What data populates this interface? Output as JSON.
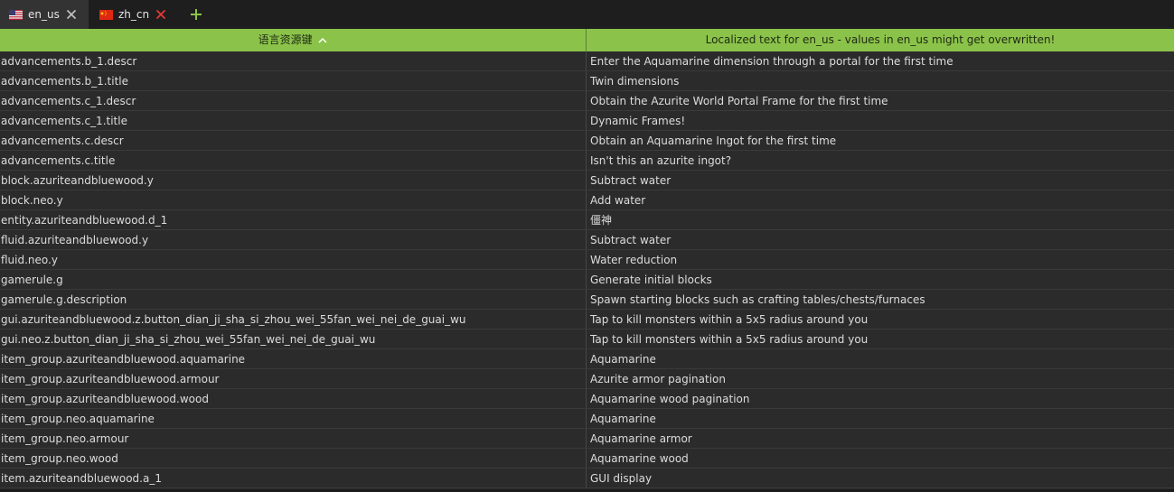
{
  "tabs": [
    {
      "label": "en_us"
    },
    {
      "label": "zh_cn"
    }
  ],
  "colors": {
    "accent": "#8bc34a",
    "close_inactive": "#e53935"
  },
  "table": {
    "headers": [
      "语言资源键",
      "Localized text for en_us - values in en_us might get overwritten!"
    ],
    "rows": [
      {
        "key": "advancements.b_1.descr",
        "value": "Enter the Aquamarine dimension through a portal for the first time"
      },
      {
        "key": "advancements.b_1.title",
        "value": "Twin dimensions"
      },
      {
        "key": "advancements.c_1.descr",
        "value": "Obtain the Azurite World Portal Frame for the first time"
      },
      {
        "key": "advancements.c_1.title",
        "value": "Dynamic Frames!"
      },
      {
        "key": "advancements.c.descr",
        "value": "Obtain an Aquamarine Ingot for the first time"
      },
      {
        "key": "advancements.c.title",
        "value": "Isn't this an azurite ingot?"
      },
      {
        "key": "block.azuriteandbluewood.y",
        "value": "Subtract water"
      },
      {
        "key": "block.neo.y",
        "value": "Add water"
      },
      {
        "key": "entity.azuriteandbluewood.d_1",
        "value": "僵神"
      },
      {
        "key": "fluid.azuriteandbluewood.y",
        "value": "Subtract water"
      },
      {
        "key": "fluid.neo.y",
        "value": "Water reduction"
      },
      {
        "key": "gamerule.g",
        "value": "Generate initial blocks"
      },
      {
        "key": "gamerule.g.description",
        "value": "Spawn starting blocks such as crafting tables/chests/furnaces"
      },
      {
        "key": "gui.azuriteandbluewood.z.button_dian_ji_sha_si_zhou_wei_55fan_wei_nei_de_guai_wu",
        "value": "Tap to kill monsters within a 5x5 radius around you"
      },
      {
        "key": "gui.neo.z.button_dian_ji_sha_si_zhou_wei_55fan_wei_nei_de_guai_wu",
        "value": "Tap to kill monsters within a 5x5 radius around you"
      },
      {
        "key": "item_group.azuriteandbluewood.aquamarine",
        "value": "Aquamarine"
      },
      {
        "key": "item_group.azuriteandbluewood.armour",
        "value": "Azurite armor pagination"
      },
      {
        "key": "item_group.azuriteandbluewood.wood",
        "value": "Aquamarine wood pagination"
      },
      {
        "key": "item_group.neo.aquamarine",
        "value": "Aquamarine"
      },
      {
        "key": "item_group.neo.armour",
        "value": "Aquamarine armor"
      },
      {
        "key": "item_group.neo.wood",
        "value": "Aquamarine wood"
      },
      {
        "key": "item.azuriteandbluewood.a_1",
        "value": "GUI display"
      }
    ]
  }
}
